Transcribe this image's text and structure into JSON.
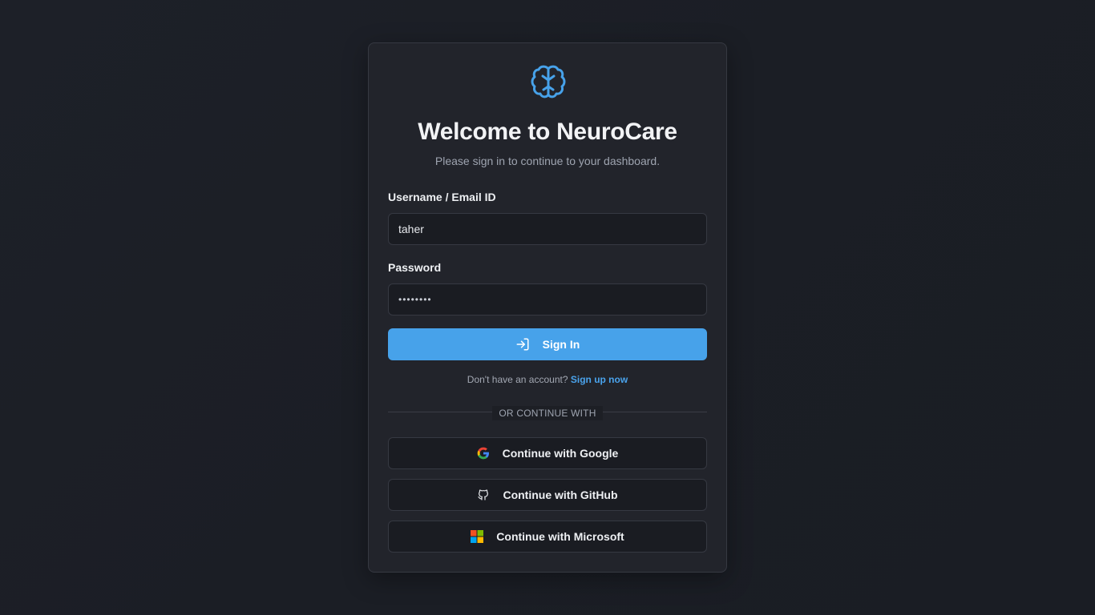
{
  "app": {
    "title": "Welcome to NeuroCare",
    "subtitle": "Please sign in to continue to your dashboard.",
    "logo_icon": "brain-icon",
    "accent": "#47a2ea"
  },
  "form": {
    "username_label": "Username / Email ID",
    "username_value": "taher",
    "password_label": "Password",
    "password_value": "taher123",
    "signin_label": "Sign In",
    "signin_icon": "sign-in-icon"
  },
  "signup": {
    "prompt": "Don't have an account?",
    "link": "Sign up now"
  },
  "divider": {
    "text": "OR CONTINUE WITH"
  },
  "oauth": {
    "google_label": "Continue with Google",
    "github_label": "Continue with GitHub",
    "microsoft_label": "Continue with Microsoft"
  }
}
